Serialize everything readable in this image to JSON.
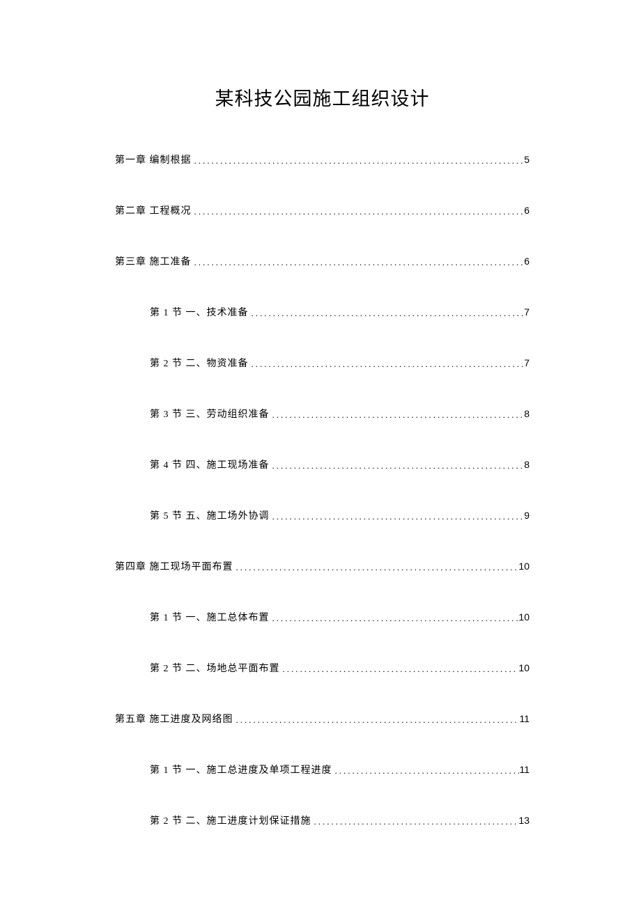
{
  "title": "某科技公园施工组织设计",
  "toc": [
    {
      "level": 1,
      "label": "第一章 编制根据",
      "page": "5"
    },
    {
      "level": 1,
      "label": "第二章 工程概况",
      "page": "6"
    },
    {
      "level": 1,
      "label": "第三章 施工准备",
      "page": "6"
    },
    {
      "level": 2,
      "label": "第 1 节 一、技术准备",
      "page": "7"
    },
    {
      "level": 2,
      "label": "第 2 节 二、物资准备",
      "page": "7"
    },
    {
      "level": 2,
      "label": "第 3 节 三、劳动组织准备",
      "page": "8"
    },
    {
      "level": 2,
      "label": "第 4 节 四、施工现场准备",
      "page": "8"
    },
    {
      "level": 2,
      "label": "第 5 节 五、施工场外协调",
      "page": "9"
    },
    {
      "level": 1,
      "label": "第四章 施工现场平面布置",
      "page": "10"
    },
    {
      "level": 2,
      "label": "第 1 节 一、施工总体布置",
      "page": "10"
    },
    {
      "level": 2,
      "label": "第 2 节 二、场地总平面布置",
      "page": "10"
    },
    {
      "level": 1,
      "label": "第五章 施工进度及网络图",
      "page": "11"
    },
    {
      "level": 2,
      "label": "第 1 节 一、施工总进度及单项工程进度",
      "page": "11"
    },
    {
      "level": 2,
      "label": "第 2 节 二、施工进度计划保证措施",
      "page": "13"
    }
  ]
}
